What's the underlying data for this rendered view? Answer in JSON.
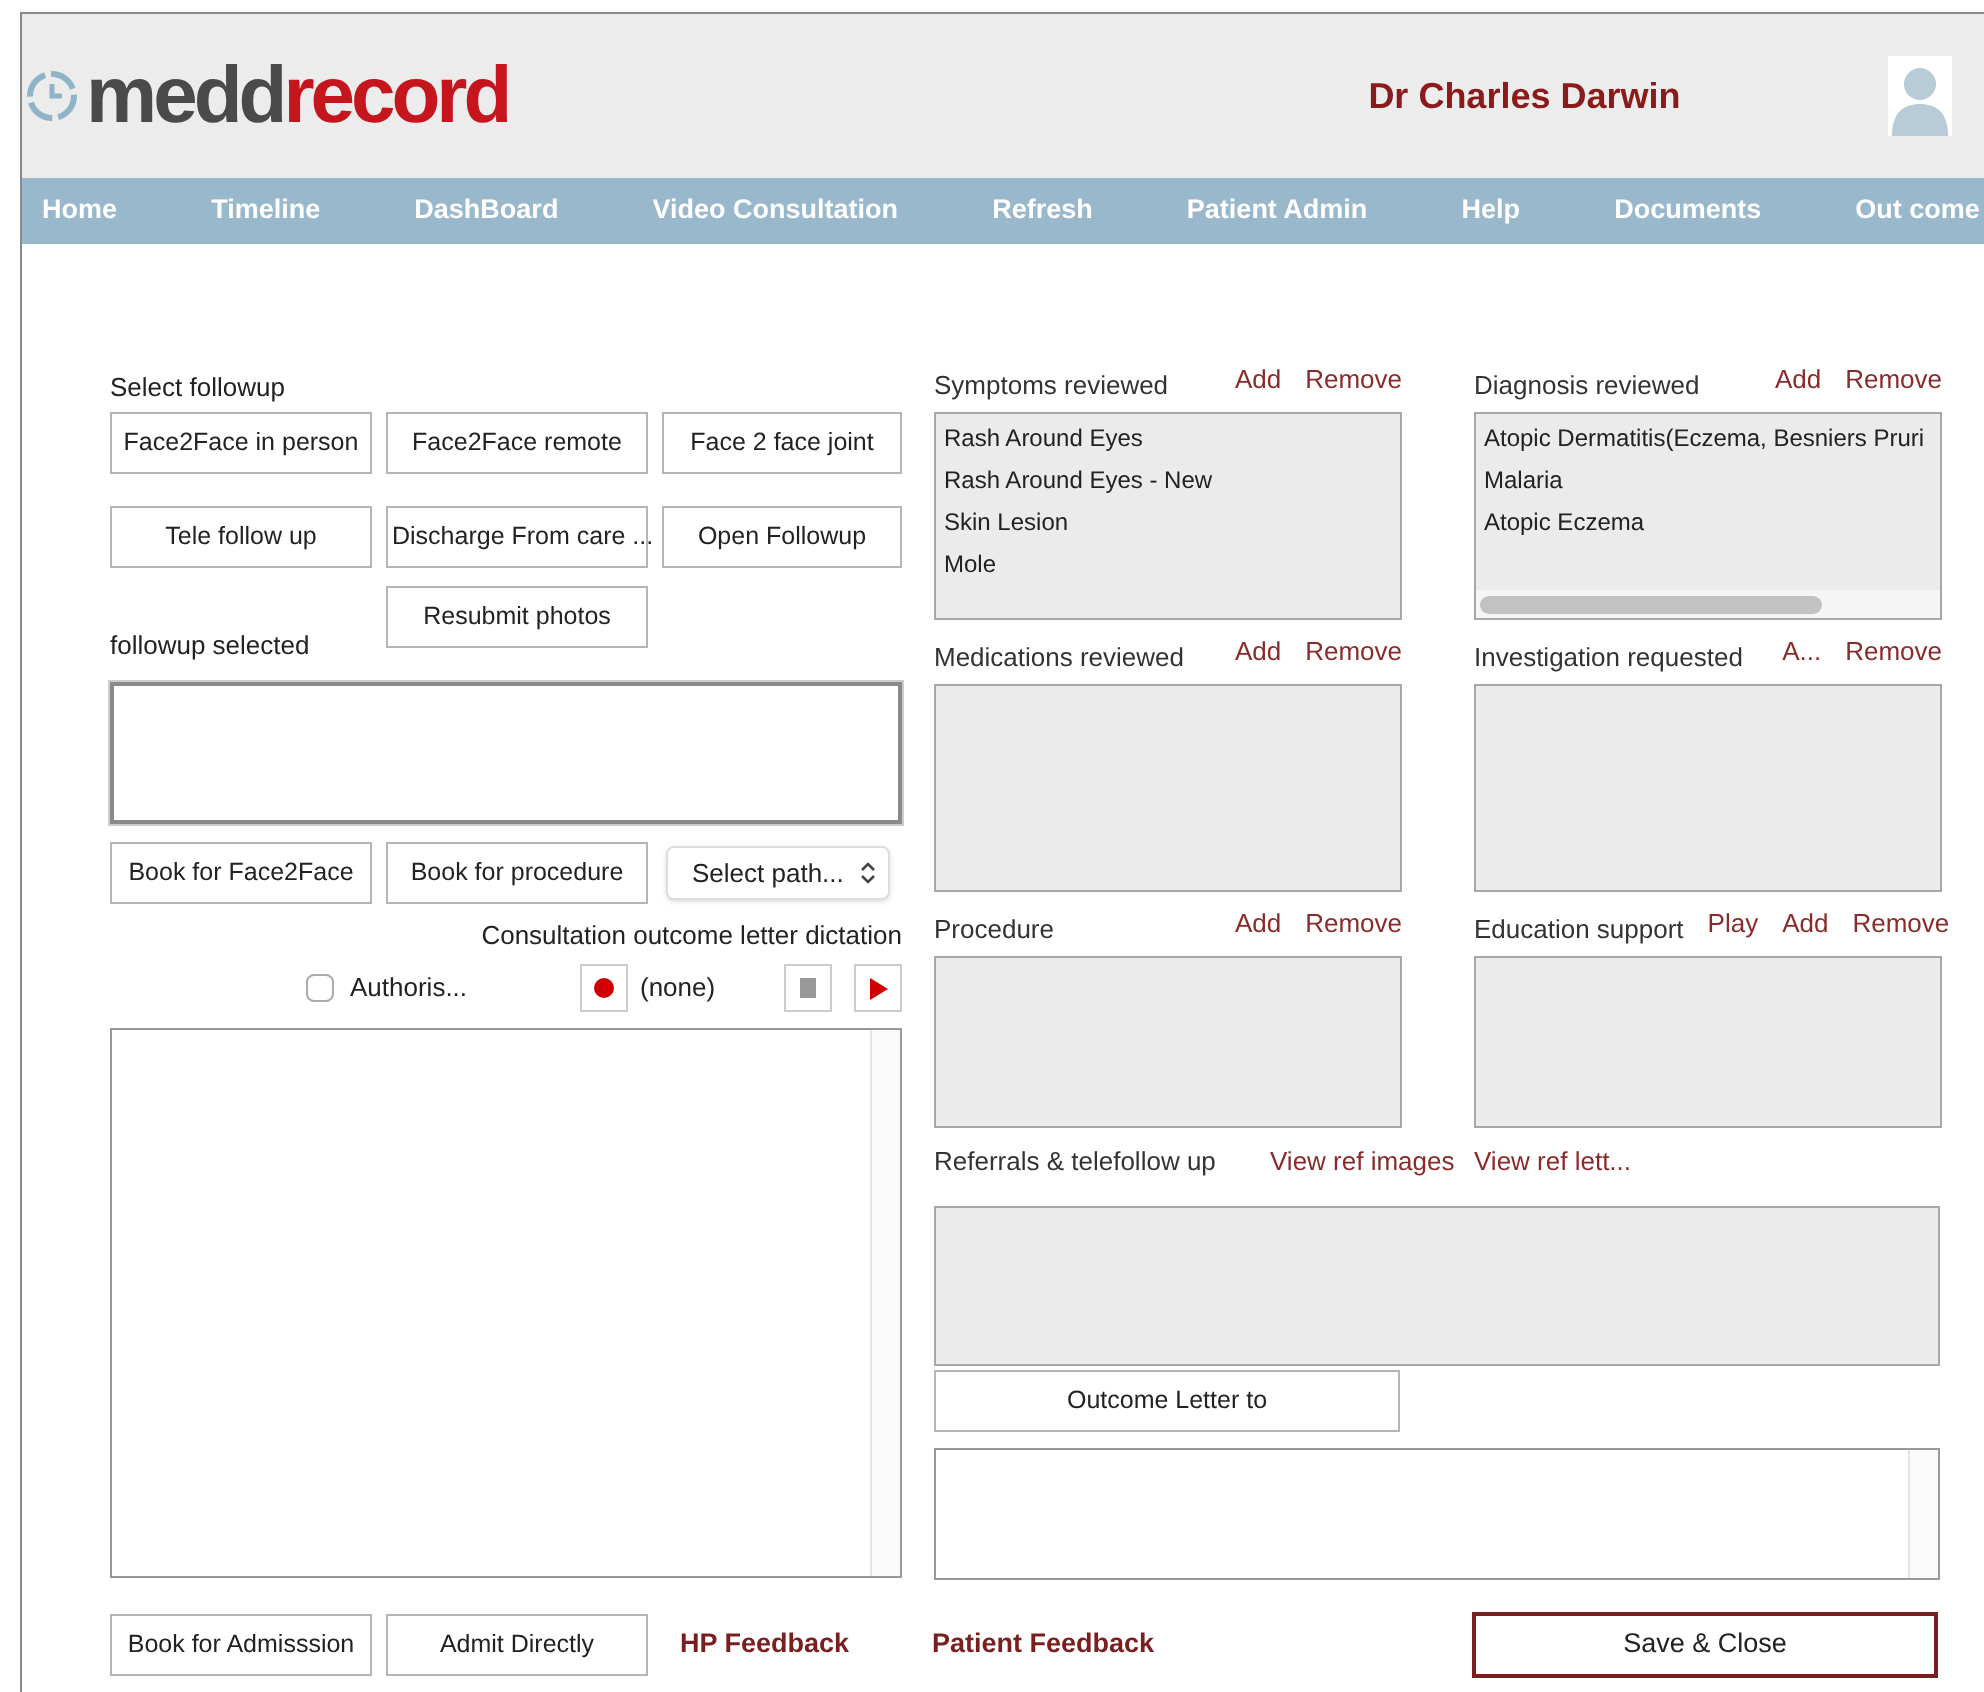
{
  "logo": {
    "part1": "medd",
    "part2": "record"
  },
  "user": {
    "name": "Dr Charles Darwin"
  },
  "nav": [
    "Home",
    "Timeline",
    "DashBoard",
    "Video Consultation",
    "Refresh",
    "Patient Admin",
    "Help",
    "Documents",
    "Out come"
  ],
  "followup": {
    "label": "Select followup",
    "options": [
      "Face2Face in person",
      "Face2Face  remote",
      "Face 2 face joint",
      "Tele follow up",
      "Discharge From care ...",
      "Open Followup",
      "Resubmit photos"
    ],
    "selected_label": "followup selected",
    "actions": [
      "Book for Face2Face",
      "Book for procedure"
    ],
    "pathway_select": {
      "value": "Select path..."
    }
  },
  "dictation": {
    "label": "Consultation outcome letter dictation",
    "authorise": {
      "label": "Authoris...",
      "checked": false
    },
    "recording": "(none)"
  },
  "panels": [
    {
      "title": "Symptoms reviewed",
      "actions": [
        "Add",
        "Remove"
      ],
      "items": [
        "Rash Around Eyes",
        "Rash Around Eyes - New",
        "Skin Lesion",
        "Mole"
      ],
      "scrollbar": false
    },
    {
      "title": "Diagnosis reviewed",
      "actions": [
        "Add",
        "Remove"
      ],
      "items": [
        "Atopic Dermatitis(Eczema, Besniers Pruri",
        "Malaria",
        "Atopic Eczema"
      ],
      "scrollbar": true
    },
    {
      "title": "Medications reviewed",
      "actions": [
        "Add",
        "Remove"
      ],
      "scrollbar": false
    },
    {
      "title": "Investigation requested",
      "actions": [
        "A...",
        "Remove"
      ],
      "scrollbar": false
    },
    {
      "title": "Procedure",
      "actions": [
        "Add",
        "Remove"
      ],
      "scrollbar": false
    },
    {
      "title": "Education support",
      "actions": [
        "Play",
        "Add",
        "Remove"
      ],
      "scrollbar": false
    }
  ],
  "referrals": {
    "title": "Referrals & telefollow up",
    "links": [
      "View ref images",
      "View ref lett..."
    ],
    "outcome_button": "Outcome Letter to"
  },
  "footer": {
    "buttons": [
      "Book for Admisssion",
      "Admit Directly"
    ],
    "links": [
      "HP Feedback",
      "Patient Feedback"
    ],
    "save": "Save & Close"
  }
}
